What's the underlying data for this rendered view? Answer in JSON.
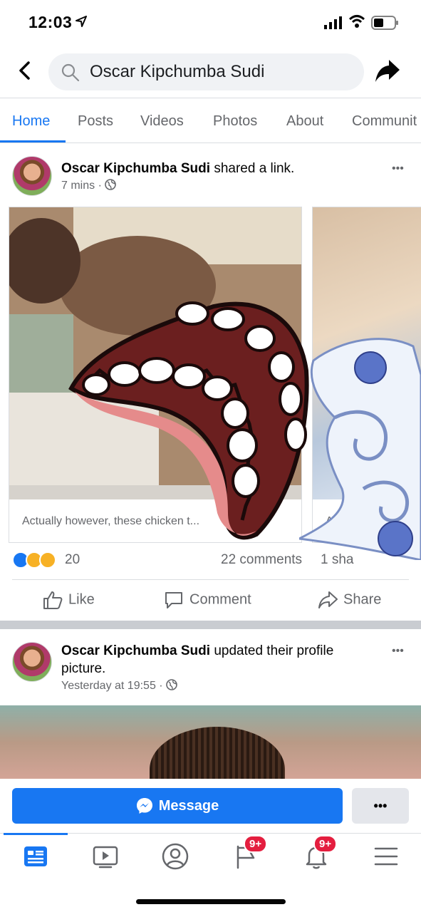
{
  "status": {
    "time": "12:03"
  },
  "search": {
    "query": "Oscar Kipchumba Sudi"
  },
  "tabs": [
    {
      "label": "Home"
    },
    {
      "label": "Posts"
    },
    {
      "label": "Videos"
    },
    {
      "label": "Photos"
    },
    {
      "label": "About"
    },
    {
      "label": "Communit"
    }
  ],
  "post1": {
    "author": "Oscar Kipchumba Sudi",
    "action": " shared a link.",
    "time": "7 mins",
    "meta_sep": " · ",
    "more": "•••",
    "card1_caption": "Actually however, these chicken t...",
    "card2_caption": "A",
    "reaction_count": "20",
    "comments": "22 comments",
    "shares": "1 sha",
    "like_label": "Like",
    "comment_label": "Comment",
    "share_label": "Share"
  },
  "post2": {
    "author": "Oscar Kipchumba Sudi",
    "action": " updated their profile picture.",
    "time": "Yesterday at 19:55",
    "meta_sep": " · ",
    "more": "•••"
  },
  "message_bar": {
    "message_label": "Message",
    "more_label": "•••"
  },
  "nav": {
    "groups_badge": "9+",
    "notifications_badge": "9+"
  },
  "colors": {
    "accent": "#1877f2",
    "badge": "#e41e3f"
  }
}
